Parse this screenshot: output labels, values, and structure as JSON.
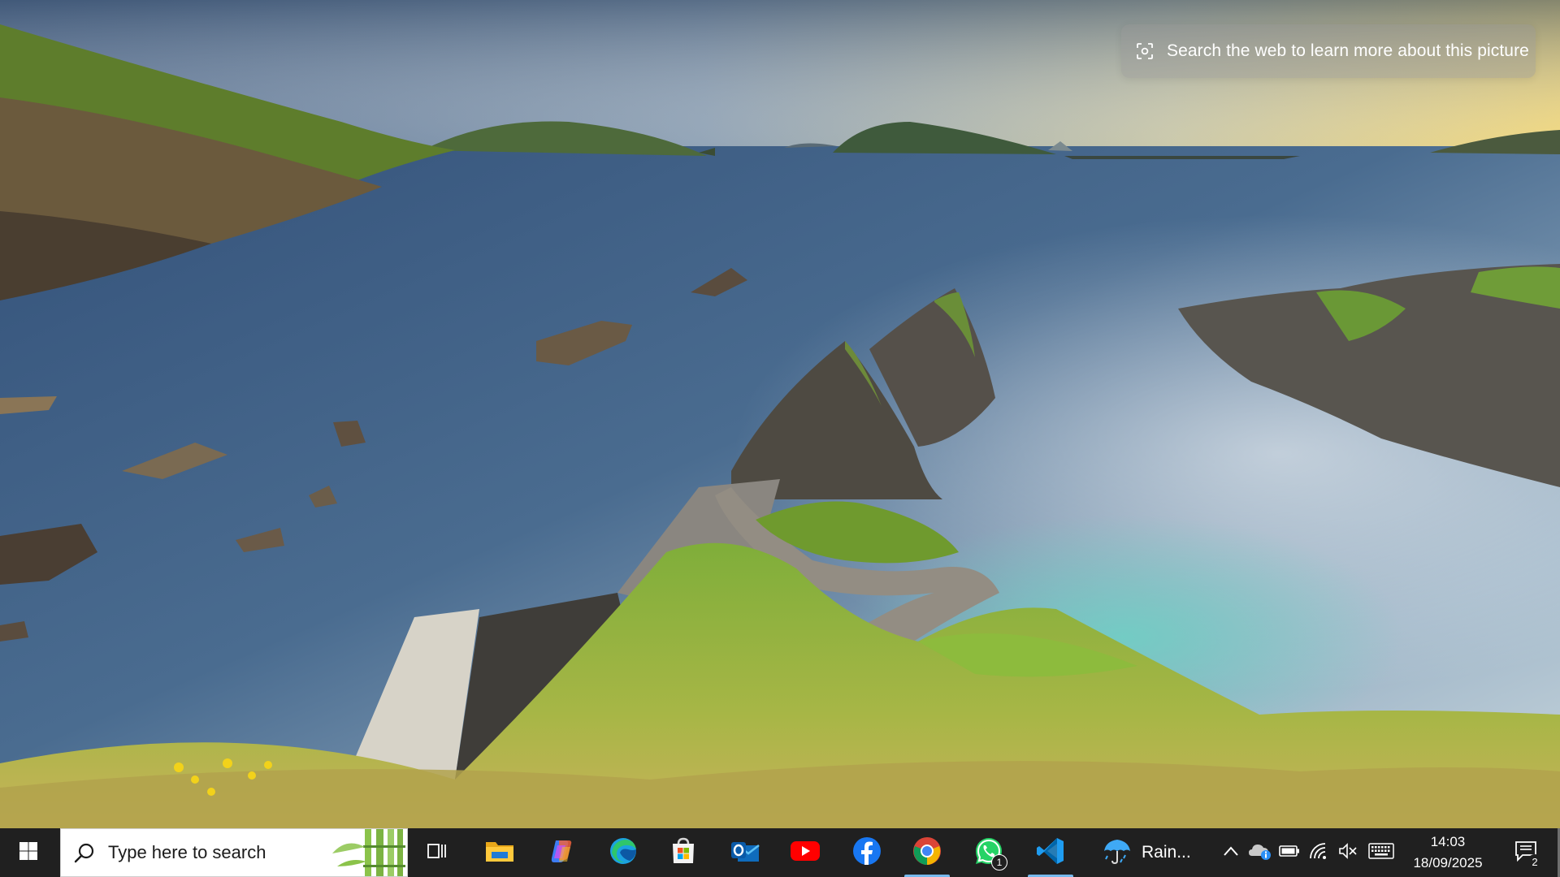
{
  "spotlight": {
    "label": "Search the web to learn more about this picture",
    "icon": "visual-search-icon"
  },
  "taskbar": {
    "start_icon": "windows-logo-icon",
    "search": {
      "placeholder": "Type here to search",
      "icon": "search-icon"
    },
    "task_view_icon": "task-view-icon",
    "apps": [
      {
        "name": "File Explorer",
        "icon": "file-explorer-icon"
      },
      {
        "name": "Copilot",
        "icon": "copilot-icon"
      },
      {
        "name": "Microsoft Edge",
        "icon": "edge-icon"
      },
      {
        "name": "Microsoft Store",
        "icon": "store-icon"
      },
      {
        "name": "Outlook",
        "icon": "outlook-icon"
      },
      {
        "name": "YouTube",
        "icon": "youtube-icon"
      },
      {
        "name": "Facebook",
        "icon": "facebook-icon"
      },
      {
        "name": "Google Chrome",
        "icon": "chrome-icon",
        "active": true
      },
      {
        "name": "WhatsApp",
        "icon": "whatsapp-icon",
        "badge": "1"
      },
      {
        "name": "Visual Studio Code",
        "icon": "vscode-icon",
        "active": true
      }
    ],
    "weather": {
      "text": "Rain...",
      "icon": "umbrella-rain-icon"
    },
    "tray": {
      "show_hidden_icon": "chevron-up-icon",
      "icons": [
        "onedrive-info-icon",
        "battery-icon",
        "wifi-icon",
        "volume-muted-icon",
        "keyboard-icon"
      ]
    },
    "clock": {
      "time": "14:03",
      "date": "18/09/2025"
    },
    "notifications": {
      "count": "2",
      "icon": "notification-center-icon"
    }
  },
  "colors": {
    "taskbar_bg": "#202020",
    "active_indicator": "#76b9ed",
    "search_bg": "#ffffff"
  }
}
